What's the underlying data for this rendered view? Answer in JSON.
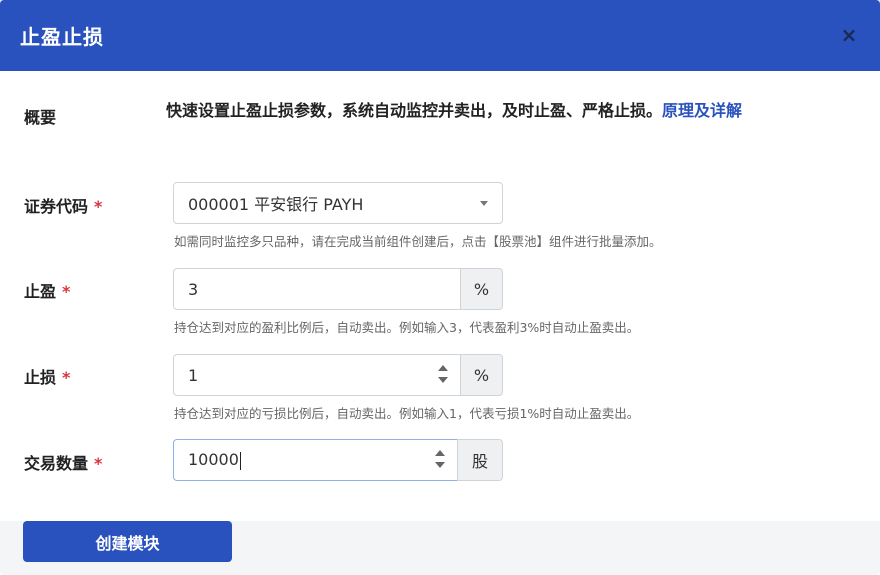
{
  "modal": {
    "title": "止盈止损",
    "close_icon": "×"
  },
  "summary": {
    "label": "概要",
    "text": "快速设置止盈止损参数，系统自动监控并卖出，及时止盈、严格止损。",
    "link_text": "原理及详解"
  },
  "security": {
    "label": "证券代码",
    "required_mark": "*",
    "selected_value": "000001 平安银行 PAYH",
    "hint": "如需同时监控多只品种，请在完成当前组件创建后，点击【股票池】组件进行批量添加。"
  },
  "take_profit": {
    "label": "止盈",
    "required_mark": "*",
    "value": "3",
    "unit": "%",
    "hint": "持仓达到对应的盈利比例后，自动卖出。例如输入3，代表盈利3%时自动止盈卖出。"
  },
  "stop_loss": {
    "label": "止损",
    "required_mark": "*",
    "value": "1",
    "unit": "%",
    "hint": "持仓达到对应的亏损比例后，自动卖出。例如输入1，代表亏损1%时自动止盈卖出。"
  },
  "quantity": {
    "label": "交易数量",
    "required_mark": "*",
    "value": "10000",
    "unit": "股"
  },
  "footer": {
    "create_label": "创建模块"
  },
  "colors": {
    "primary": "#2a52be",
    "required": "#d9343a",
    "hint": "#666666"
  }
}
